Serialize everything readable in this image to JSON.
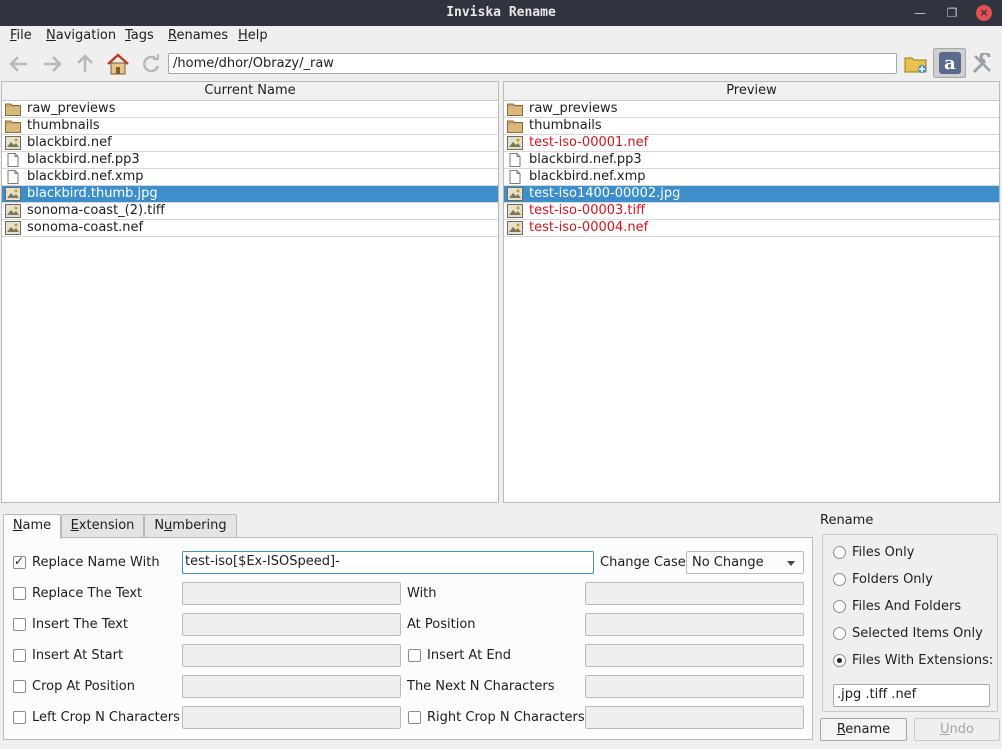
{
  "window": {
    "title": "Inviska Rename"
  },
  "menu": [
    {
      "label": "File",
      "mnemonic": "F",
      "rest": "ile"
    },
    {
      "label": "Navigation",
      "mnemonic": "N",
      "rest": "avigation"
    },
    {
      "label": "Tags",
      "mnemonic": "T",
      "rest": "ags"
    },
    {
      "label": "Renames",
      "mnemonic": "R",
      "rest": "enames"
    },
    {
      "label": "Help",
      "mnemonic": "H",
      "rest": "elp"
    }
  ],
  "toolbar": {
    "path": "/home/dhor/Obrazy/_raw",
    "icons": [
      "back-icon",
      "forward-icon",
      "up-icon",
      "home-icon",
      "refresh-icon",
      "open-folder-icon",
      "auto-rename-icon",
      "settings-icon"
    ]
  },
  "current": {
    "header": "Current Name",
    "rows": [
      {
        "name": "raw_previews",
        "type": "folder"
      },
      {
        "name": "thumbnails",
        "type": "folder"
      },
      {
        "name": "blackbird.nef",
        "type": "image"
      },
      {
        "name": "blackbird.nef.pp3",
        "type": "text"
      },
      {
        "name": "blackbird.nef.xmp",
        "type": "text"
      },
      {
        "name": "blackbird.thumb.jpg",
        "type": "image",
        "selected": true
      },
      {
        "name": "sonoma-coast_(2).tiff",
        "type": "image"
      },
      {
        "name": "sonoma-coast.nef",
        "type": "image"
      }
    ]
  },
  "preview": {
    "header": "Preview",
    "rows": [
      {
        "name": "raw_previews",
        "type": "folder"
      },
      {
        "name": "thumbnails",
        "type": "folder"
      },
      {
        "name": "test-iso-00001.nef",
        "type": "image",
        "renamed": true
      },
      {
        "name": "blackbird.nef.pp3",
        "type": "text"
      },
      {
        "name": "blackbird.nef.xmp",
        "type": "text"
      },
      {
        "name": "test-iso1400-00002.jpg",
        "type": "image",
        "selected": true,
        "renamed": true
      },
      {
        "name": "test-iso-00003.tiff",
        "type": "image",
        "renamed": true
      },
      {
        "name": "test-iso-00004.nef",
        "type": "image",
        "renamed": true
      }
    ]
  },
  "tabs": {
    "name": {
      "label": "Name",
      "mnemonic": "N",
      "rest": "ame"
    },
    "extension": {
      "label": "Extension",
      "mnemonic": "E",
      "rest": "xtension"
    },
    "numbering": {
      "label": "Numbering",
      "mnemonic": "u",
      "pre": "N",
      "rest": "mbering"
    }
  },
  "name_tab": {
    "replace_name_with": {
      "label": "Replace Name With",
      "checked": true,
      "value": "test-iso[$Ex-ISOSpeed]-"
    },
    "change_case": {
      "label": "Change Case",
      "value": "No Change"
    },
    "replace_the_text": {
      "label": "Replace The Text",
      "checked": false
    },
    "with": {
      "label": "With"
    },
    "insert_the_text": {
      "label": "Insert The Text",
      "checked": false
    },
    "at_position": {
      "label": "At Position"
    },
    "insert_at_start": {
      "label": "Insert At Start",
      "checked": false
    },
    "insert_at_end": {
      "label": "Insert At End",
      "checked": false
    },
    "crop_at_position": {
      "label": "Crop At Position",
      "checked": false
    },
    "next_n_chars": {
      "label": "The Next N Characters"
    },
    "left_crop": {
      "label": "Left Crop N Characters",
      "checked": false
    },
    "right_crop": {
      "label": "Right Crop N Characters",
      "checked": false
    }
  },
  "rename_group": {
    "title": "Rename",
    "options": [
      {
        "label": "Files Only",
        "checked": false
      },
      {
        "label": "Folders Only",
        "checked": false
      },
      {
        "label": "Files And Folders",
        "checked": false
      },
      {
        "label": "Selected Items Only",
        "checked": false
      },
      {
        "label": "Files With Extensions:",
        "checked": true
      }
    ],
    "extensions": ".jpg .tiff .nef",
    "rename_button": {
      "label": "Rename",
      "mnemonic": "R",
      "rest": "ename"
    },
    "undo_button": {
      "label": "Undo",
      "mnemonic": "U",
      "rest": "ndo",
      "enabled": false
    }
  }
}
